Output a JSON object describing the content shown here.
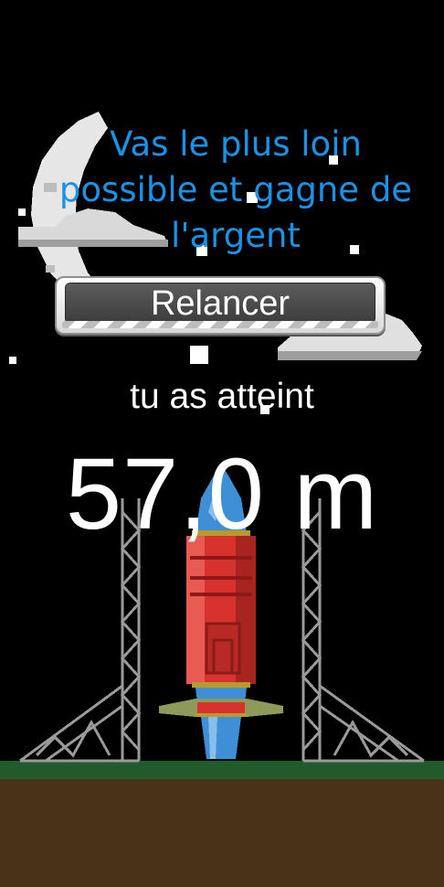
{
  "hud": {
    "objective_lines": [
      "Vas le plus loin",
      "possible et gagne de",
      "l'argent"
    ],
    "restart_label": "Relancer",
    "reached_label": "tu as atteint",
    "distance": "57,0 m"
  },
  "colors": {
    "sky": "#000000",
    "objective_text": "#1a93e6",
    "grass": "#215a2b",
    "soil": "#4a3219",
    "rocket_body": "#d8322e",
    "rocket_nose": "#3f8fd6"
  }
}
